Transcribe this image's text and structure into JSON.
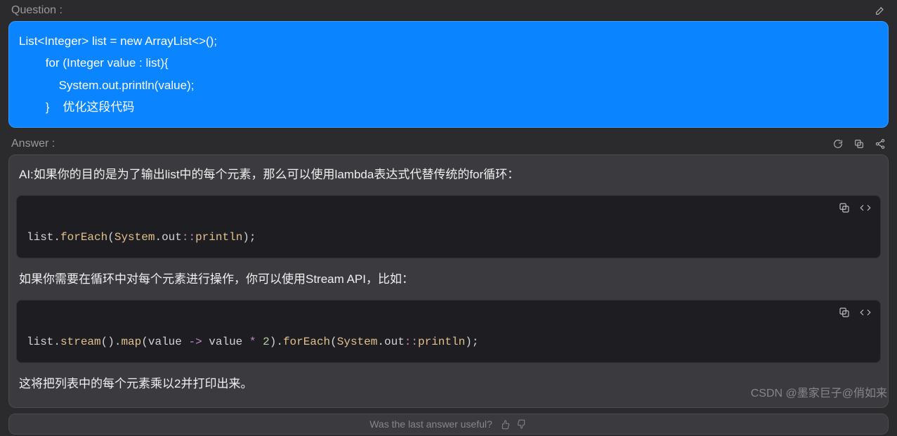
{
  "question": {
    "label": "Question :",
    "text": "List<Integer> list = new ArrayList<>();\n        for (Integer value : list){\n            System.out.println(value);\n        }    优化这段代码"
  },
  "answer": {
    "label": "Answer :",
    "intro": "AI:如果你的目的是为了输出list中的每个元素，那么可以使用lambda表达式代替传统的for循环：",
    "code1": {
      "tokens": [
        {
          "t": "list",
          "c": "c-var"
        },
        {
          "t": ".",
          "c": "c-dot"
        },
        {
          "t": "forEach",
          "c": "c-method"
        },
        {
          "t": "(",
          "c": "c-paren"
        },
        {
          "t": "System",
          "c": "c-class"
        },
        {
          "t": ".",
          "c": "c-dot"
        },
        {
          "t": "out",
          "c": "c-var"
        },
        {
          "t": "::",
          "c": "c-punct-colon"
        },
        {
          "t": "println",
          "c": "c-method"
        },
        {
          "t": ")",
          "c": "c-paren"
        },
        {
          "t": ";",
          "c": "c-semi"
        }
      ]
    },
    "mid": "如果你需要在循环中对每个元素进行操作，你可以使用Stream API，比如：",
    "code2": {
      "tokens": [
        {
          "t": "list",
          "c": "c-var"
        },
        {
          "t": ".",
          "c": "c-dot"
        },
        {
          "t": "stream",
          "c": "c-method"
        },
        {
          "t": "()",
          "c": "c-paren"
        },
        {
          "t": ".",
          "c": "c-dot"
        },
        {
          "t": "map",
          "c": "c-method"
        },
        {
          "t": "(",
          "c": "c-paren"
        },
        {
          "t": "value ",
          "c": "c-var"
        },
        {
          "t": "->",
          "c": "c-op"
        },
        {
          "t": " value ",
          "c": "c-var"
        },
        {
          "t": "*",
          "c": "c-op"
        },
        {
          "t": " ",
          "c": "c-var"
        },
        {
          "t": "2",
          "c": "c-num"
        },
        {
          "t": ")",
          "c": "c-paren"
        },
        {
          "t": ".",
          "c": "c-dot"
        },
        {
          "t": "forEach",
          "c": "c-method"
        },
        {
          "t": "(",
          "c": "c-paren"
        },
        {
          "t": "System",
          "c": "c-class"
        },
        {
          "t": ".",
          "c": "c-dot"
        },
        {
          "t": "out",
          "c": "c-var"
        },
        {
          "t": "::",
          "c": "c-punct-colon"
        },
        {
          "t": "println",
          "c": "c-method"
        },
        {
          "t": ")",
          "c": "c-paren"
        },
        {
          "t": ";",
          "c": "c-semi"
        }
      ]
    },
    "outro": "这将把列表中的每个元素乘以2并打印出来。"
  },
  "footer": {
    "prompt": "Was the last answer useful?"
  },
  "watermark": "CSDN @墨家巨子@俏如来"
}
